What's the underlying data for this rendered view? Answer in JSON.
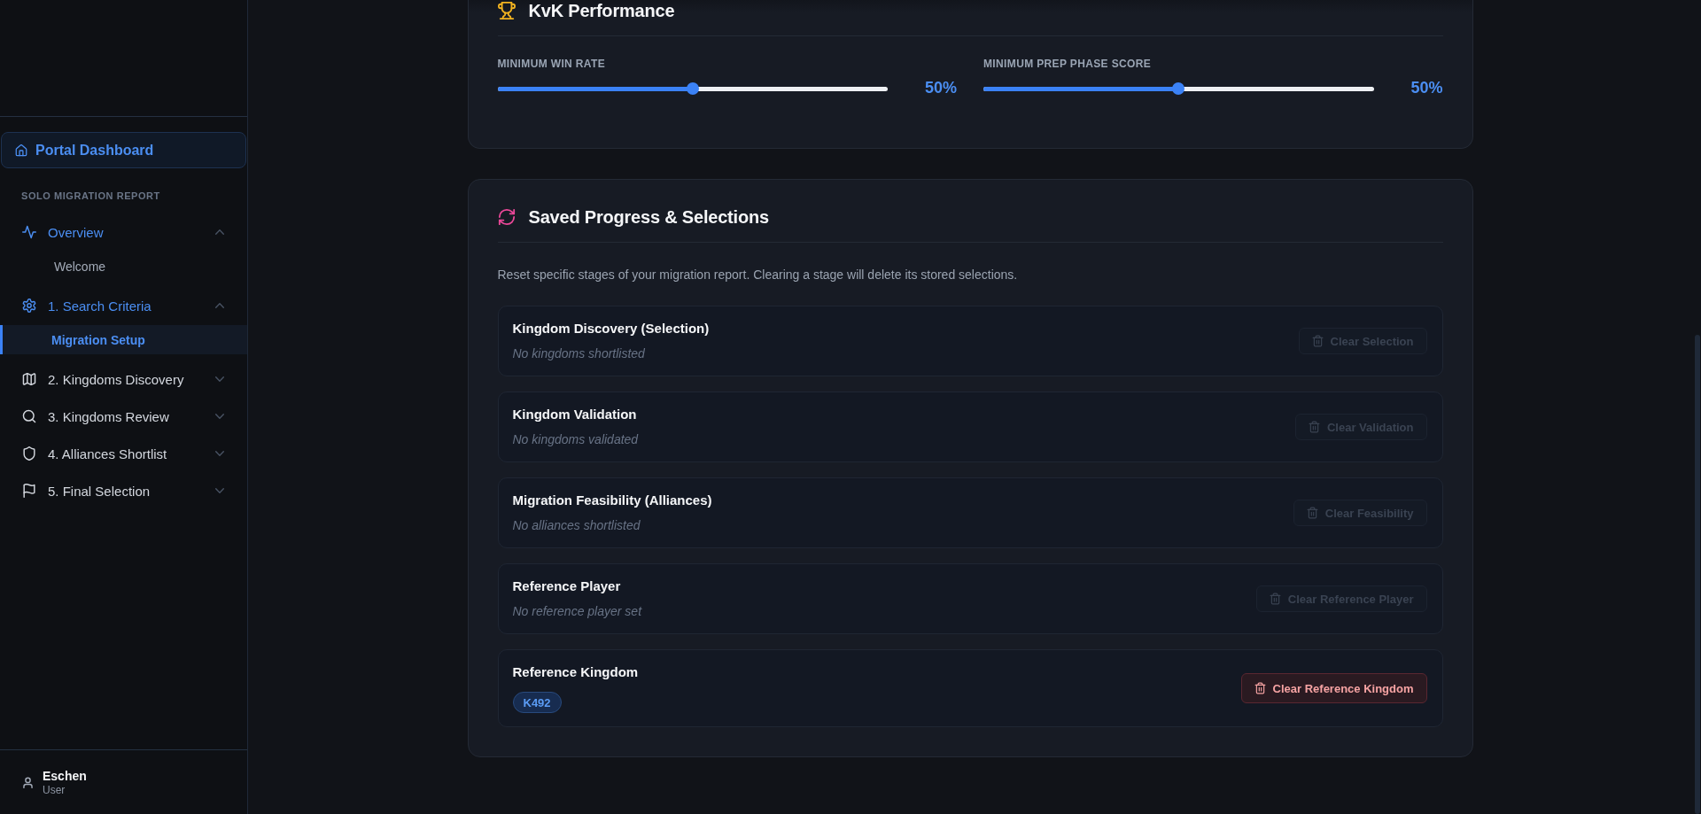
{
  "sidebar": {
    "home_link": "Portal Dashboard",
    "section_label": "SOLO MIGRATION REPORT",
    "items": [
      {
        "label": "Overview",
        "expanded": true,
        "children": [
          {
            "label": "Welcome",
            "selected": false
          }
        ]
      },
      {
        "label": "1. Search Criteria",
        "expanded": true,
        "children": [
          {
            "label": "Migration Setup",
            "selected": true
          }
        ]
      },
      {
        "label": "2. Kingdoms Discovery",
        "expanded": false
      },
      {
        "label": "3. Kingdoms Review",
        "expanded": false
      },
      {
        "label": "4. Alliances Shortlist",
        "expanded": false
      },
      {
        "label": "5. Final Selection",
        "expanded": false
      }
    ],
    "user": {
      "name": "Eschen",
      "role": "User"
    }
  },
  "kvk_performance": {
    "title": "KvK Performance",
    "sliders": [
      {
        "label": "MINIMUM WIN RATE",
        "level": 0.5,
        "reading": "50%"
      },
      {
        "label": "MINIMUM PREP PHASE SCORE",
        "level": 0.5,
        "reading": "50%"
      }
    ]
  },
  "saved_progress": {
    "title": "Saved Progress & Selections",
    "description": "Reset specific stages of your migration report. Clearing a stage will delete its stored selections.",
    "stages": [
      {
        "kind": "status",
        "title": "Kingdom Discovery (Selection)",
        "value": "No kingdoms shortlisted",
        "button": "Clear Selection",
        "disabled": true
      },
      {
        "kind": "status",
        "title": "Kingdom Validation",
        "value": "No kingdoms validated",
        "button": "Clear Validation",
        "disabled": true
      },
      {
        "kind": "status",
        "title": "Migration Feasibility (Alliances)",
        "value": "No alliances shortlisted",
        "button": "Clear Feasibility",
        "disabled": true
      },
      {
        "kind": "status",
        "title": "Reference Player",
        "value": "No reference player set",
        "button": "Clear Reference Player",
        "disabled": true
      },
      {
        "kind": "tag",
        "title": "Reference Kingdom",
        "value": "K492",
        "button": "Clear Reference Kingdom",
        "disabled": false
      }
    ]
  }
}
